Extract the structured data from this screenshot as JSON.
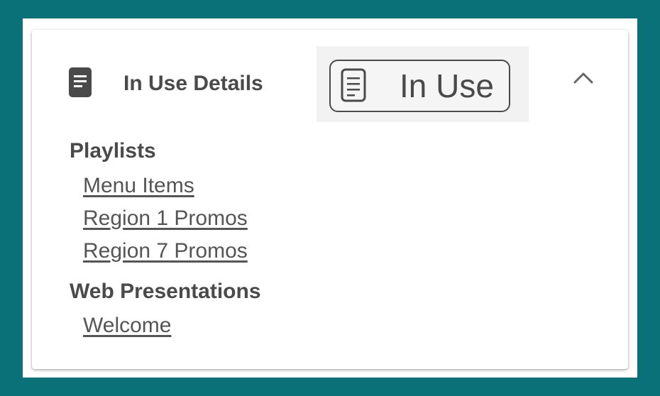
{
  "panel": {
    "title": "In Use Details",
    "title_icon": "document-icon",
    "status_label": "In Use",
    "status_icon": "document-icon",
    "collapse_icon": "chevron-up-icon"
  },
  "sections": [
    {
      "heading": "Playlists",
      "items": [
        "Menu Items",
        "Region 1 Promos",
        "Region 7 Promos"
      ]
    },
    {
      "heading": "Web Presentations",
      "items": [
        "Welcome"
      ]
    }
  ],
  "colors": {
    "background": "#0a7178",
    "text": "#4a4a4a",
    "link": "#555555",
    "status_bg": "#f2f2f2"
  }
}
